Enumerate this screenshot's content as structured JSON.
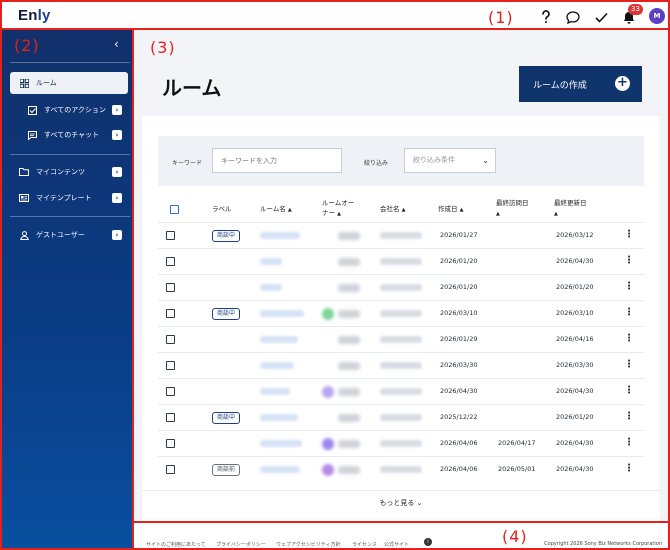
{
  "header": {
    "logo": "Enly",
    "zone_label": "(1)",
    "notification_count": "33",
    "avatar_initial": "M",
    "icons": [
      "help-icon",
      "chat-icon",
      "check-icon",
      "bell-icon"
    ]
  },
  "sidebar": {
    "zone_label": "(2)",
    "collapse_glyph": "‹",
    "items": [
      {
        "label": "ルーム",
        "icon": "grid-icon",
        "active": true
      },
      {
        "label": "すべてのアクション",
        "icon": "checkbox-icon"
      },
      {
        "label": "すべてのチャット",
        "icon": "message-icon"
      },
      {
        "label": "マイコンテンツ",
        "icon": "folder-icon"
      },
      {
        "label": "マイテンプレート",
        "icon": "template-icon"
      },
      {
        "label": "ゲストユーザー",
        "icon": "person-icon"
      }
    ]
  },
  "main": {
    "zone_label": "(3)",
    "title": "ルーム",
    "create_button": "ルームの作成",
    "filter": {
      "keyword_label": "キーワード",
      "keyword_placeholder": "キーワードを入力",
      "narrow_label": "絞り込み",
      "narrow_placeholder": "絞り込み条件"
    },
    "table": {
      "headers": {
        "label": "ラベル",
        "room_name": "ルーム名",
        "owner_line1": "ルームオー",
        "owner_line2": "ナー",
        "company": "会社名",
        "created": "作成日",
        "last_visit": "最終訪問日",
        "last_update": "最終更新日"
      },
      "rows": [
        {
          "label": "商談中",
          "label_style": "blue",
          "created": "2026/01/27",
          "visited": "",
          "updated": "2026/03/12",
          "name_w": 40,
          "owner_dot": "#ffffff"
        },
        {
          "label": "",
          "created": "2026/01/20",
          "visited": "",
          "updated": "2026/04/30",
          "name_w": 22,
          "owner_dot": "#ffffff"
        },
        {
          "label": "",
          "created": "2026/01/20",
          "visited": "",
          "updated": "2026/01/20",
          "name_w": 22,
          "owner_dot": "#ffffff"
        },
        {
          "label": "商談中",
          "label_style": "blue",
          "created": "2026/03/10",
          "visited": "",
          "updated": "2026/03/10",
          "name_w": 44,
          "owner_dot": "#7fd49a"
        },
        {
          "label": "",
          "created": "2026/01/29",
          "visited": "",
          "updated": "2026/04/16",
          "name_w": 38,
          "owner_dot": "#ffffff"
        },
        {
          "label": "",
          "created": "2026/03/30",
          "visited": "",
          "updated": "2026/03/30",
          "name_w": 34,
          "owner_dot": "#ffffff"
        },
        {
          "label": "",
          "created": "2026/04/30",
          "visited": "",
          "updated": "2026/04/30",
          "name_w": 30,
          "owner_dot": "#b7a6ee"
        },
        {
          "label": "商談中",
          "label_style": "blue",
          "created": "2025/12/22",
          "visited": "",
          "updated": "2026/01/20",
          "name_w": 38,
          "owner_dot": "#ffffff"
        },
        {
          "label": "",
          "created": "2026/04/06",
          "visited": "2026/04/17",
          "updated": "2026/04/30",
          "name_w": 42,
          "owner_dot": "#9d86ee"
        },
        {
          "label": "商談前",
          "label_style": "grey",
          "created": "2026/04/06",
          "visited": "2026/05/01",
          "updated": "2026/04/30",
          "name_w": 40,
          "owner_dot": "#b48ae8"
        }
      ]
    },
    "more": "もっと見る"
  },
  "footer": {
    "zone_label": "(4)",
    "links": [
      "サイトのご利用にあたって",
      "プライバシーポリシー",
      "ウェブアクセシビリティ方針",
      "ライセンス",
      "公式サイト"
    ],
    "copyright": "Copyright 2026 Sony Biz Networks Corporation"
  },
  "colors": {
    "accent": "#10356d",
    "annotation": "#e5211c",
    "sidebar": "#0a3d86",
    "badge": "#d93636"
  }
}
